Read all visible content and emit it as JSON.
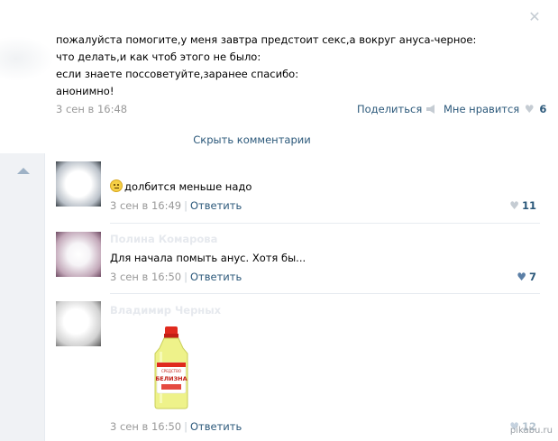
{
  "post": {
    "lines": [
      "пожалуйста помогите,у меня завтра предстоит секс,а вокруг ануса-черное:",
      "что делать,и как чтоб этого не было:",
      "если знаете поссоветуйте,заранее спасибо:",
      "анонимно!"
    ],
    "date": "3 сен в 16:48",
    "share_label": "Поделиться",
    "like_label": "Мне нравится",
    "like_count": "6"
  },
  "hide_comments_label": "Скрыть комментарии",
  "comments": [
    {
      "author": "",
      "text": "долбится меньше надо",
      "date": "3 сен в 16:49",
      "reply_label": "Ответить",
      "likes": "11",
      "emoji": "neutral-face"
    },
    {
      "author": "Полина Комарова",
      "text": "Для начала помыть анус. Хотя бы...",
      "date": "3 сен в 16:50",
      "reply_label": "Ответить",
      "likes": "7"
    },
    {
      "author": "Владимир Черных",
      "text": "",
      "date": "3 сен в 16:50",
      "reply_label": "Ответить",
      "likes": "12",
      "image": {
        "label_line1": "СРЕДСТВО",
        "label_line2": "БЕЛИЗНА"
      }
    }
  ],
  "watermark": "pikabu.ru",
  "colors": {
    "link": "#2b587a",
    "meta": "#999999",
    "panel": "#f0f2f5",
    "heart_inactive": "#c5ccd3",
    "heart_active": "#5b7fa6"
  },
  "icons": {
    "close": "close-icon",
    "share": "megaphone-icon",
    "like": "heart-icon",
    "collapse": "arrow-up-icon"
  }
}
